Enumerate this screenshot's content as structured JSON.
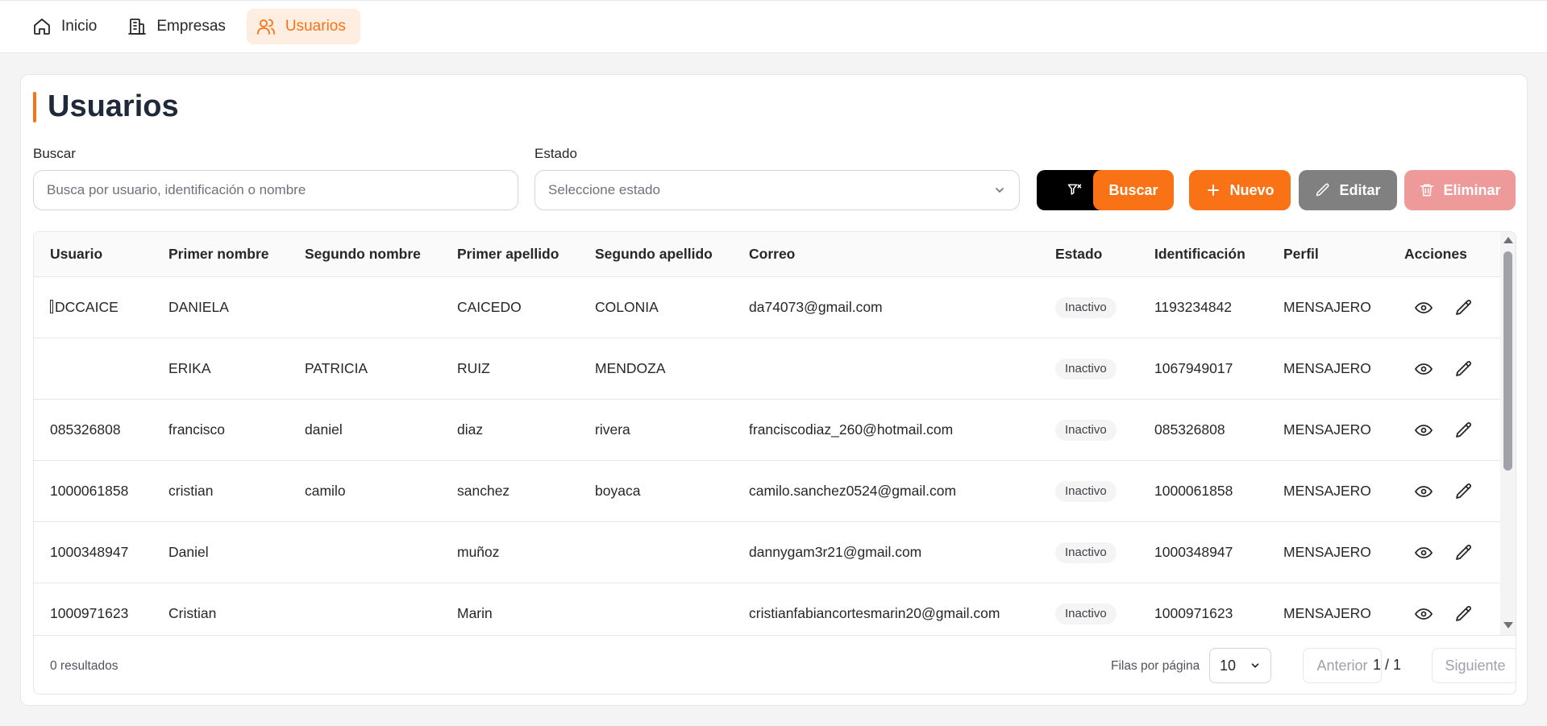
{
  "nav": {
    "items": [
      {
        "label": "Inicio",
        "icon": "home-icon"
      },
      {
        "label": "Empresas",
        "icon": "building-icon"
      },
      {
        "label": "Usuarios",
        "icon": "users-icon",
        "active": true
      }
    ]
  },
  "page": {
    "title": "Usuarios"
  },
  "filters": {
    "search_label": "Buscar",
    "search_placeholder": "Busca por usuario, identificación o nombre",
    "search_value": "",
    "status_label": "Estado",
    "status_placeholder": "Seleccione estado"
  },
  "buttons": {
    "clear_filter_icon": "filter-clear-icon",
    "search": "Buscar",
    "new": "Nuevo",
    "edit": "Editar",
    "delete": "Eliminar"
  },
  "colors": {
    "accent": "#f97316",
    "edit": "#808080",
    "delete": "#ef9a9a",
    "dark": "#000000"
  },
  "table": {
    "columns": [
      "Usuario",
      "Primer nombre",
      "Segundo nombre",
      "Primer apellido",
      "Segundo apellido",
      "Correo",
      "Estado",
      "Identificación",
      "Perfil",
      "Acciones"
    ],
    "rows": [
      {
        "usuario": "DCCAICE",
        "usuario_prefix_glyph": true,
        "primer_nombre": "DANIELA",
        "segundo_nombre": "",
        "primer_apellido": "CAICEDO",
        "segundo_apellido": "COLONIA",
        "correo": "da74073@gmail.com",
        "estado": "Inactivo",
        "identificacion": "1193234842",
        "perfil": "MENSAJERO"
      },
      {
        "usuario": "",
        "primer_nombre": "ERIKA",
        "segundo_nombre": "PATRICIA",
        "primer_apellido": "RUIZ",
        "segundo_apellido": "MENDOZA",
        "correo": "",
        "estado": "Inactivo",
        "identificacion": "1067949017",
        "perfil": "MENSAJERO"
      },
      {
        "usuario": "085326808",
        "primer_nombre": "francisco",
        "segundo_nombre": "daniel",
        "primer_apellido": "diaz",
        "segundo_apellido": "rivera",
        "correo": "franciscodiaz_260@hotmail.com",
        "estado": "Inactivo",
        "identificacion": "085326808",
        "perfil": "MENSAJERO"
      },
      {
        "usuario": "1000061858",
        "primer_nombre": "cristian",
        "segundo_nombre": "camilo",
        "primer_apellido": "sanchez",
        "segundo_apellido": "boyaca",
        "correo": "camilo.sanchez0524@gmail.com",
        "estado": "Inactivo",
        "identificacion": "1000061858",
        "perfil": "MENSAJERO"
      },
      {
        "usuario": "1000348947",
        "primer_nombre": "Daniel",
        "segundo_nombre": "",
        "primer_apellido": "muñoz",
        "segundo_apellido": "",
        "correo": "dannygam3r21@gmail.com",
        "estado": "Inactivo",
        "identificacion": "1000348947",
        "perfil": "MENSAJERO"
      },
      {
        "usuario": "1000971623",
        "primer_nombre": "Cristian",
        "segundo_nombre": "",
        "primer_apellido": "Marin",
        "segundo_apellido": "",
        "correo": "cristianfabiancortesmarin20@gmail.com",
        "estado": "Inactivo",
        "identificacion": "1000971623",
        "perfil": "MENSAJERO"
      }
    ],
    "action_icons": [
      "eye-icon",
      "pencil-icon"
    ]
  },
  "footer": {
    "results": "0 resultados",
    "rows_per_page_label": "Filas por página",
    "rows_per_page": "10",
    "prev": "Anterior",
    "page_indicator": "1 / 1",
    "next": "Siguiente"
  }
}
